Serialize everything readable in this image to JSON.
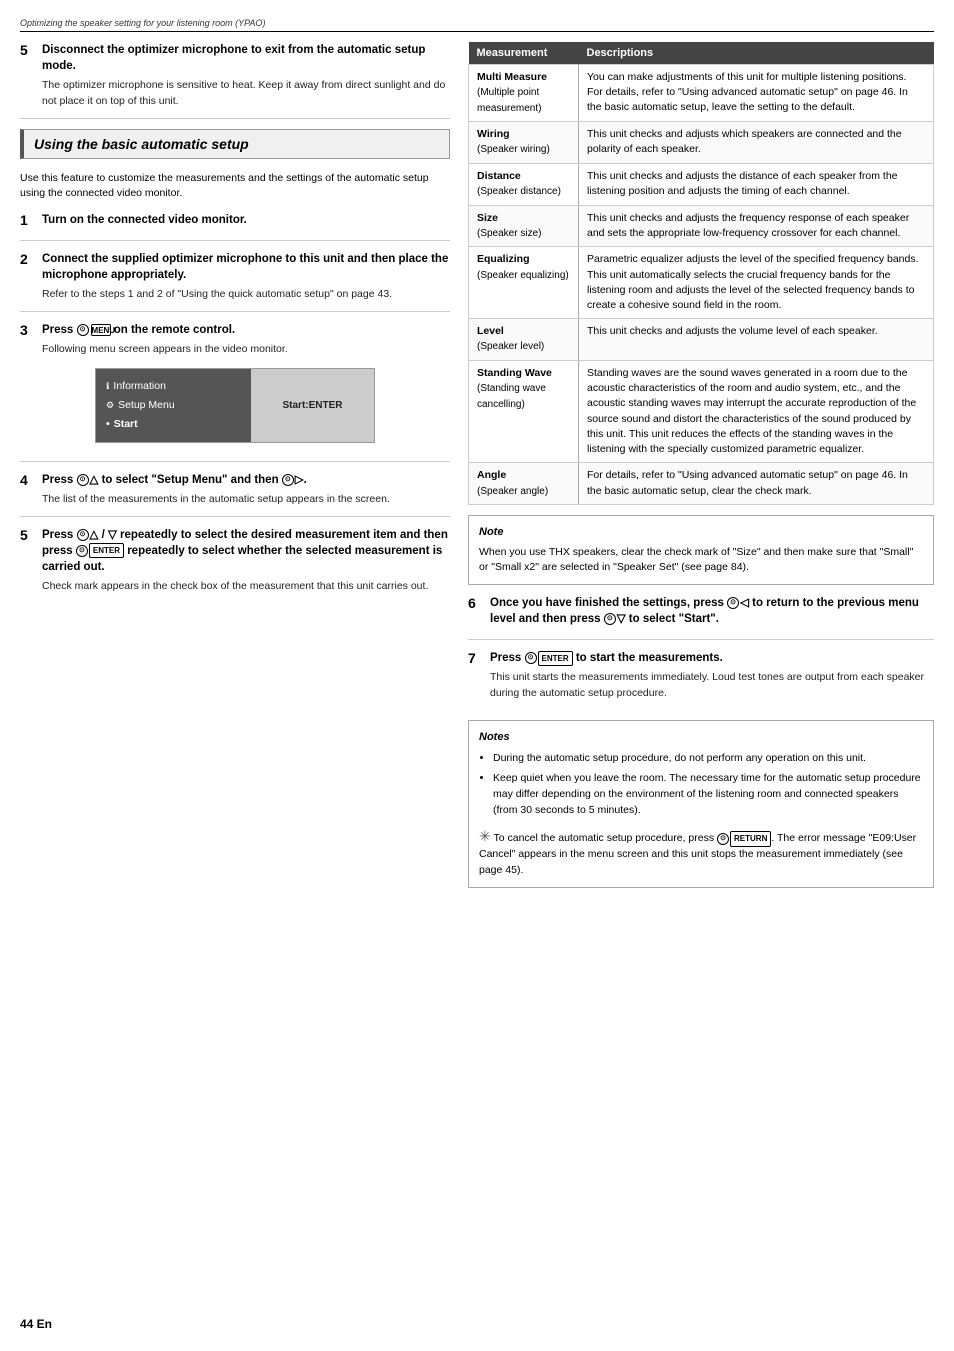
{
  "header": {
    "text": "Optimizing the speaker setting for your listening room (YPAO)"
  },
  "left": {
    "section_title": "Using the basic automatic setup",
    "intro": "Use this feature to customize the measurements and the settings of the automatic setup using the connected video monitor.",
    "steps": [
      {
        "number": "5",
        "title": "Disconnect the optimizer microphone to exit from the automatic setup mode.",
        "body": "The optimizer microphone is sensitive to heat. Keep it away from direct sunlight and do not place it on top of this unit.",
        "pre_section": true
      },
      {
        "number": "1",
        "title": "Turn on the connected video monitor.",
        "body": ""
      },
      {
        "number": "2",
        "title": "Connect the supplied optimizer microphone to this unit and then place the microphone appropriately.",
        "body": "Refer to the steps 1 and 2 of \"Using the quick automatic setup\" on page 43."
      },
      {
        "number": "3",
        "title": "Press MENU on the remote control.",
        "title_suffix": "",
        "body": "Following menu screen appears in the video monitor."
      },
      {
        "number": "4",
        "title": "Press to select \"Setup Menu\" and then .",
        "body": "The list of the measurements in the automatic setup appears in the screen."
      },
      {
        "number": "5",
        "title": "Press / repeatedly to select the desired measurement item and then press ENTER repeatedly to select whether the selected measurement is carried out.",
        "body": "Check mark appears in the check box of the measurement that this unit carries out."
      }
    ],
    "menu": {
      "items": [
        "Information",
        "Setup Menu",
        "Start"
      ],
      "selected": "Start",
      "right_label": "Start:ENTER"
    }
  },
  "right": {
    "table": {
      "col1": "Measurement",
      "col2": "Descriptions",
      "rows": [
        {
          "name": "Multi Measure",
          "sub": "(Multiple point measurement)",
          "desc": "You can make adjustments of this unit for multiple listening positions. For details, refer to \"Using advanced automatic setup\" on page 46. In the basic automatic setup, leave the setting to the default."
        },
        {
          "name": "Wiring",
          "sub": "(Speaker wiring)",
          "desc": "This unit checks and adjusts which speakers are connected and the polarity of each speaker."
        },
        {
          "name": "Distance",
          "sub": "(Speaker distance)",
          "desc": "This unit checks and adjusts the distance of each speaker from the listening position and adjusts the timing of each channel."
        },
        {
          "name": "Size",
          "sub": "(Speaker size)",
          "desc": "This unit checks and adjusts the frequency response of each speaker and sets the appropriate low-frequency crossover for each channel."
        },
        {
          "name": "Equalizing",
          "sub": "(Speaker equalizing)",
          "desc": "Parametric equalizer adjusts the level of the specified frequency bands. This unit automatically selects the crucial frequency bands for the listening room and adjusts the level of the selected frequency bands to create a cohesive sound field in the room."
        },
        {
          "name": "Level",
          "sub": "(Speaker level)",
          "desc": "This unit checks and adjusts the volume level of each speaker."
        },
        {
          "name": "Standing Wave",
          "sub": "(Standing wave cancelling)",
          "desc": "Standing waves are the sound waves generated in a room due to the acoustic characteristics of the room and audio system, etc., and the acoustic standing waves may interrupt the accurate reproduction of the source sound and distort the characteristics of the sound produced by this unit. This unit reduces the effects of the standing waves in the listening with the specially customized parametric equalizer."
        },
        {
          "name": "Angle",
          "sub": "(Speaker angle)",
          "desc": "For details, refer to \"Using advanced automatic setup\" on page 46. In the basic automatic setup, clear the check mark."
        }
      ]
    },
    "note_single": {
      "title": "Note",
      "text": "When you use THX speakers, clear the check mark of \"Size\" and then make sure that \"Small\" or \"Small x2\" are selected in \"Speaker Set\" (see page 84)."
    },
    "steps": [
      {
        "number": "6",
        "title": "Once you have finished the settings, press to return to the previous menu level and then press to select \"Start\"."
      },
      {
        "number": "7",
        "title": "Press ENTER to start the measurements.",
        "body": "This unit starts the measurements immediately. Loud test tones are output from each speaker during the automatic setup procedure."
      }
    ],
    "notes": {
      "title": "Notes",
      "items": [
        "During the automatic setup procedure, do not perform any operation on this unit.",
        "Keep quiet when you leave the room. The necessary time for the automatic setup procedure may differ depending on the environment of the listening room and connected speakers (from 30 seconds to 5 minutes)."
      ],
      "tip": "To cancel the automatic setup procedure, press RETURN. The error message \"E09:User Cancel\" appears in the menu screen and this unit stops the measurement immediately (see page 45)."
    }
  },
  "footer": {
    "page": "44 En"
  }
}
